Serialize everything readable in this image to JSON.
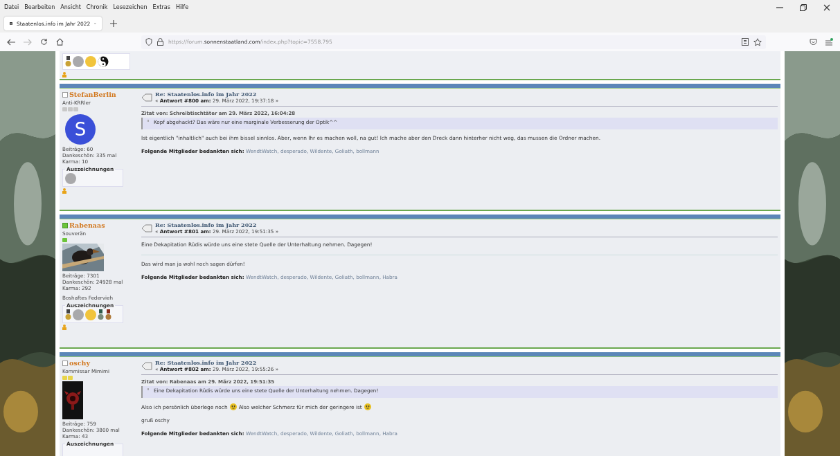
{
  "menu": [
    "Datei",
    "Bearbeiten",
    "Ansicht",
    "Chronik",
    "Lesezeichen",
    "Extras",
    "Hilfe"
  ],
  "tab": {
    "title": "Staatenlos.info im Jahr 2022",
    "selected": true
  },
  "url": {
    "prefix": "https://forum.",
    "domain": "sonnenstaatland.com",
    "path": "/index.php?topic=7558.795"
  },
  "top_fragment": {
    "awards": [
      {
        "kind": "medal-ribbon"
      },
      {
        "kind": "silver-coin"
      },
      {
        "kind": "gold-coin"
      },
      {
        "kind": "yin-yang"
      }
    ]
  },
  "thanks_separator": ", ",
  "posts": [
    {
      "author": "StefanBerlin",
      "online": false,
      "rank": "Anti-KRRler",
      "pips": [
        {
          "color": "#c8c8c8"
        },
        {
          "color": "#c8c8c8"
        },
        {
          "color": "#c8c8c8"
        }
      ],
      "avatar": {
        "kind": "letter",
        "letter": "S"
      },
      "stats": [
        "Beiträge: 60",
        "Dankeschön: 335 mal",
        "Karma: 10"
      ],
      "awards_label": "Auszeichnungen",
      "awards": [
        {
          "kind": "silver-coin"
        }
      ],
      "subject": "Re: Staatenlos.info im Jahr 2022",
      "meta": "« **Antwort #800 am:** 29. März 2022, 19:37:18 »",
      "quote": {
        "header": "Zitat von: Schreibtischtäter am 29. März 2022, 16:04:28",
        "text": "Kopf abgehackt? Das wäre nur eine marginale Verbesserung der Optik^^"
      },
      "body": [
        [
          {
            "kind": "text",
            "text": "Ist eigentlich \"inhaltlich\" auch bei ihm bissel sinnlos. Aber, wenn Ihr es machen woll, na gut! Ich mache aber den Dreck dann hinterher nicht weg, das mussen die Ordner machen."
          }
        ]
      ],
      "thanks_label": "Folgende Mitglieder bedankten sich:",
      "thanks": [
        "WendtWatch",
        "desperado",
        "Wildente",
        "Goliath",
        "bollmann"
      ]
    },
    {
      "author": "Rabenaas",
      "online": true,
      "rank": "Souverän",
      "pips": [
        {
          "color": "#6cc43a"
        }
      ],
      "avatar": {
        "kind": "picture"
      },
      "stats": [
        "Beiträge: 7301",
        "Dankeschön: 24928 mal",
        "Karma: 292"
      ],
      "custom_title": "Boshaftes Federvieh",
      "awards_label": "Auszeichnungen",
      "awards": [
        {
          "kind": "medal-ribbon"
        },
        {
          "kind": "silver-coin"
        },
        {
          "kind": "gold-coin"
        },
        {
          "kind": "green-medal"
        },
        {
          "kind": "bronze-medal"
        }
      ],
      "subject": "Re: Staatenlos.info im Jahr 2022",
      "meta": "« **Antwort #801 am:** 29. März 2022, 19:51:35 »",
      "body": [
        [
          {
            "kind": "text",
            "text": "Eine Dekapitation Rüdis würde uns eine stete Quelle der Unterhaltung nehmen. Dagegen!"
          }
        ]
      ],
      "signature": "Das wird man ja wohl noch sagen dürfen!",
      "thanks_label": "Folgende Mitglieder bedankten sich:",
      "thanks": [
        "WendtWatch",
        "desperado",
        "Wildente",
        "Goliath",
        "bollmann",
        "Habra"
      ]
    },
    {
      "author": "oschy",
      "online": false,
      "rank": "Kommissar Mimimi",
      "pips": [
        {
          "color": "#e8d44a"
        },
        {
          "color": "#e8d44a"
        }
      ],
      "avatar": {
        "kind": "picture"
      },
      "stats": [
        "Beiträge: 759",
        "Dankeschön: 3800 mal",
        "Karma: 43"
      ],
      "awards_label": "Auszeichnungen",
      "subject": "Re: Staatenlos.info im Jahr 2022",
      "meta": "« **Antwort #802 am:** 29. März 2022, 19:55:26 »",
      "quote": {
        "header": "Zitat von: Rabenaas am 29. März 2022, 19:51:35",
        "text": "Eine Dekapitation Rüdis würde uns eine stete Quelle der Unterhaltung nehmen. Dagegen!"
      },
      "body": [
        [
          {
            "kind": "text",
            "text": "Also ich persönlich überlege noch"
          },
          {
            "kind": "smiley"
          },
          {
            "kind": "text",
            "text": "Also welcher Schmerz für mich der geringere ist"
          },
          {
            "kind": "smiley"
          }
        ],
        [
          {
            "kind": "text",
            "text": "gruß oschy"
          }
        ]
      ],
      "thanks_label": "Folgende Mitglieder bedankten sich:",
      "thanks": [
        "WendtWatch",
        "desperado",
        "Wildente",
        "Goliath",
        "bollmann",
        "Habra"
      ]
    }
  ]
}
